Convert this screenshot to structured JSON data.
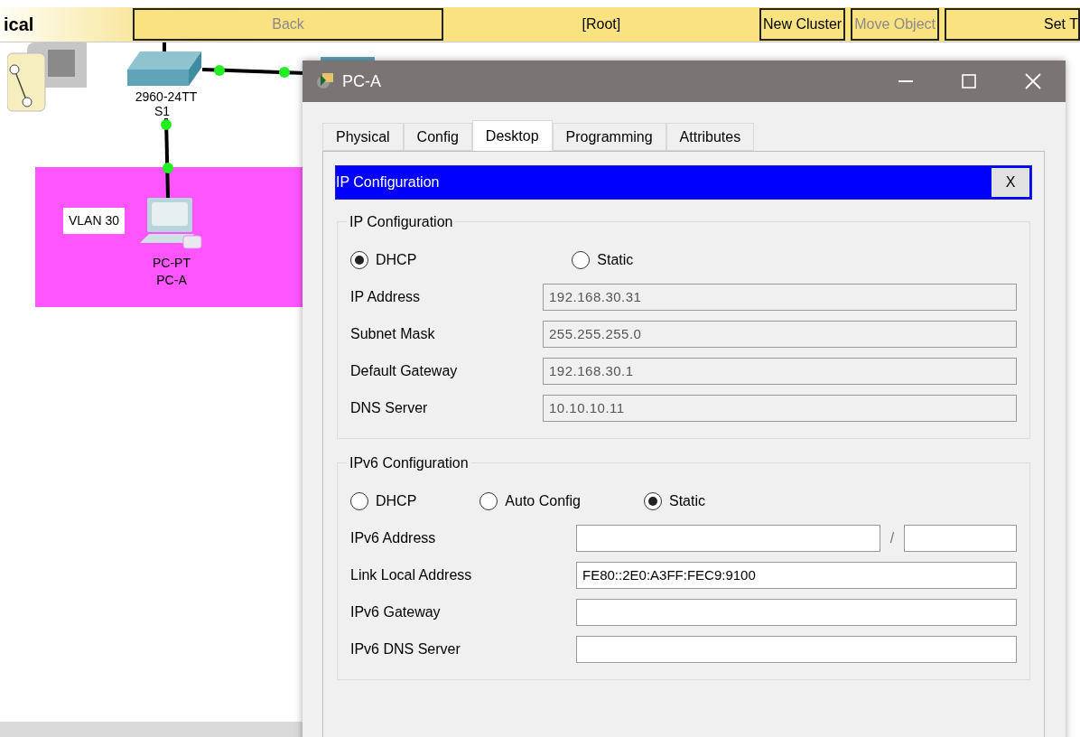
{
  "toolbar": {
    "title": "ical",
    "path": "[Root]",
    "buttons": [
      {
        "label": "Back",
        "disabled": true,
        "kind": "wide"
      },
      {
        "label": "New Cluster",
        "disabled": false,
        "kind": "normal"
      },
      {
        "label": "Move Object",
        "disabled": true,
        "kind": "normal"
      },
      {
        "label": "Set T",
        "disabled": false,
        "kind": "cut"
      }
    ]
  },
  "topology": {
    "zone_label": "VLAN 30",
    "switch": {
      "model": "2960-24TT",
      "name": "S1"
    },
    "pc": {
      "model": "PC-PT",
      "name": "PC-A"
    }
  },
  "dialog": {
    "title": "PC-A",
    "tabs": [
      {
        "label": "Physical",
        "selected": false
      },
      {
        "label": "Config",
        "selected": false
      },
      {
        "label": "Desktop",
        "selected": true
      },
      {
        "label": "Programming",
        "selected": false
      },
      {
        "label": "Attributes",
        "selected": false
      }
    ],
    "app": {
      "title": "IP Configuration",
      "close": "X"
    },
    "ipv4": {
      "legend": "IP Configuration",
      "modes": [
        {
          "label": "DHCP",
          "selected": true
        },
        {
          "label": "Static",
          "selected": false
        }
      ],
      "fields": [
        {
          "label": "IP Address",
          "value": "192.168.30.31",
          "disabled": true,
          "kind": "single"
        },
        {
          "label": "Subnet Mask",
          "value": "255.255.255.0",
          "disabled": true,
          "kind": "single"
        },
        {
          "label": "Default Gateway",
          "value": "192.168.30.1",
          "disabled": true,
          "kind": "single"
        },
        {
          "label": "DNS Server",
          "value": "10.10.10.11",
          "disabled": true,
          "kind": "single"
        }
      ]
    },
    "ipv6": {
      "legend": "IPv6 Configuration",
      "modes": [
        {
          "label": "DHCP",
          "selected": false
        },
        {
          "label": "Auto Config",
          "selected": false
        },
        {
          "label": "Static",
          "selected": true
        }
      ],
      "fields": [
        {
          "label": "IPv6 Address",
          "disabled": false,
          "kind": "prefixed",
          "separator": "/"
        },
        {
          "label": "Link Local Address",
          "value": "FE80::2E0:A3FF:FEC9:9100",
          "disabled": false,
          "kind": "single"
        },
        {
          "label": "IPv6 Gateway",
          "disabled": false,
          "kind": "single"
        },
        {
          "label": "IPv6 DNS Server",
          "disabled": false,
          "kind": "single"
        }
      ]
    }
  }
}
